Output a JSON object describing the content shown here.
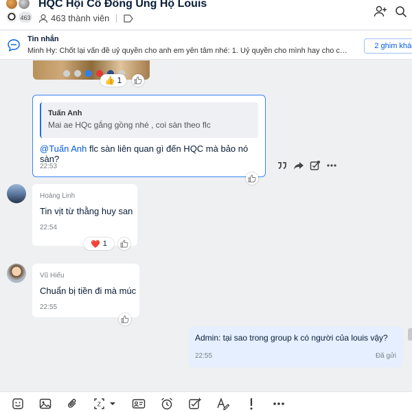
{
  "header": {
    "title": "HQC Hội Cổ Đông Ủng Hộ Louis",
    "avatar_count": "463",
    "members": "463 thành viên",
    "add_member_icon": "add-member-icon",
    "search_icon": "search-icon"
  },
  "pinned": {
    "label": "Tin nhắn",
    "text": "Minh Hy: Chốt lại vấn đề uỷ quyền cho anh em yên tâm nhé: 1. Uỷ quyền cho mình hay cho chị ...",
    "button": "2 ghim khác"
  },
  "messages": {
    "image_reaction": {
      "emoji": "👍",
      "count": "1"
    },
    "selected": {
      "quote_name": "Tuấn Anh",
      "quote_text": "Mai ae HQc gắng gồng nhé , coi sàn theo flc",
      "mention": "@Tuấn Anh",
      "text": " flc sàn liên quan gì đến HQC mà bảo nó sàn?",
      "time": "22:53"
    },
    "hoang_linh": {
      "sender": "Hoàng Linh",
      "text": "Tin vịt từ thằng huy san",
      "time": "22:54",
      "reaction_emoji": "❤️",
      "reaction_count": "1"
    },
    "vu_hieu": {
      "sender": "Vũ Hiếu",
      "text": "Chuẩn bị tiền đi mà múc",
      "time": "22:55"
    },
    "mine": {
      "text": "Admin: tại sao trong group k có người của louis vậy?",
      "time": "22:55",
      "status": "Đã gửi"
    }
  },
  "colors": {
    "accent": "#005ae0",
    "selected_border": "#3b82f6",
    "my_bubble": "#e5efff",
    "chat_bg": "#eef0f2"
  }
}
